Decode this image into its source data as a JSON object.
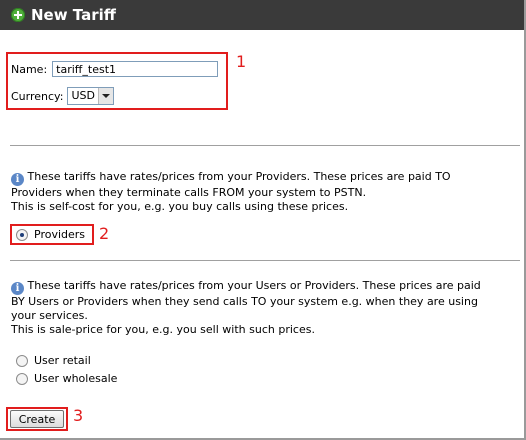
{
  "title": "New Tariff",
  "form": {
    "name_label": "Name:",
    "name_value": "tariff_test1",
    "currency_label": "Currency:",
    "currency_value": "USD"
  },
  "providers_section": {
    "info_line1": "These tariffs have rates/prices from your Providers. These prices are paid TO",
    "info_line2": "Providers when they terminate calls FROM your system to PSTN.",
    "info_line3": "This is self-cost for you, e.g. you buy calls using these prices.",
    "option_label": "Providers",
    "selected": true
  },
  "users_section": {
    "info_line1": "These tariffs have rates/prices from your Users or Providers. These prices are paid",
    "info_line2": "BY Users or Providers when they send calls TO your system e.g. when they are using",
    "info_line3": "your services.",
    "info_line4": "This is sale-price for you, e.g. you sell with such prices.",
    "options": [
      {
        "label": "User retail",
        "selected": false
      },
      {
        "label": "User wholesale",
        "selected": false
      }
    ]
  },
  "create_label": "Create",
  "callouts": [
    "1",
    "2",
    "3"
  ],
  "colors": {
    "titlebar": "#3a3a3a",
    "callout": "#e11d1d",
    "info_icon": "#5b87c7",
    "plus_icon": "#4fae3a"
  },
  "icons": [
    "plus-icon",
    "info-icon"
  ]
}
